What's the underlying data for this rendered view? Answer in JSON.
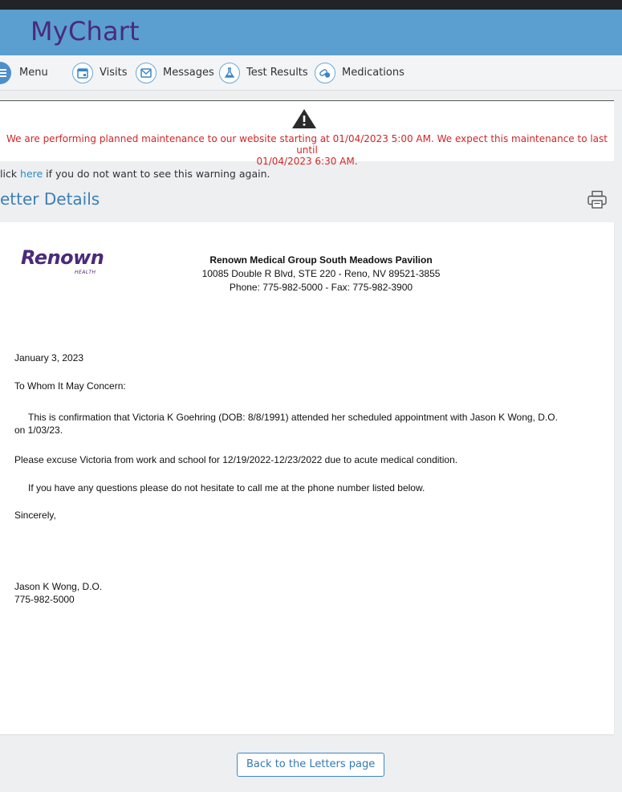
{
  "app": {
    "title": "MyChart"
  },
  "nav": {
    "menu": "Menu",
    "visits": "Visits",
    "messages": "Messages",
    "test_results": "Test Results",
    "medications": "Medications"
  },
  "notice": {
    "line1": "We are performing planned maintenance to our website starting at 01/04/2023 5:00 AM. We expect this maintenance to last until",
    "line2": "01/04/2023 6:30 AM."
  },
  "dismiss": {
    "prefix": "lick ",
    "link": "here",
    "suffix": " if you do not want to see this warning again."
  },
  "page_title": "etter Details",
  "letter": {
    "logo_name": "Renown",
    "logo_sub": "HEALTH",
    "clinic_name": "Renown Medical Group South Meadows Pavilion",
    "clinic_address": "10085 Double R Blvd,   STE 220 - Reno, NV 89521-3855",
    "clinic_phone": "Phone:  775-982-5000 - Fax:  775-982-3900",
    "date": "January 3, 2023",
    "greeting": "To Whom It May Concern:",
    "para1_line1": "This is confirmation that Victoria K Goehring (DOB: 8/8/1991) attended her scheduled appointment with Jason K Wong, D.O.",
    "para1_line2": "on 1/03/23.",
    "para2": "Please excuse Victoria from work and school for 12/19/2022-12/23/2022 due to acute medical condition.",
    "para3": "If you have any questions please do not hesitate to call me at the phone number listed below.",
    "closing": "Sincerely,",
    "signer": "Jason K Wong, D.O.",
    "signer_phone": "775-982-5000"
  },
  "back_button": "Back to the Letters page",
  "colors": {
    "header": "#5a9fcf",
    "brand": "#4b2a7a",
    "warning": "#d12626",
    "link": "#2a8bc9"
  },
  "icons": [
    "menu-icon",
    "visits-icon",
    "messages-icon",
    "test-results-icon",
    "medications-icon",
    "warning-icon",
    "print-icon"
  ]
}
